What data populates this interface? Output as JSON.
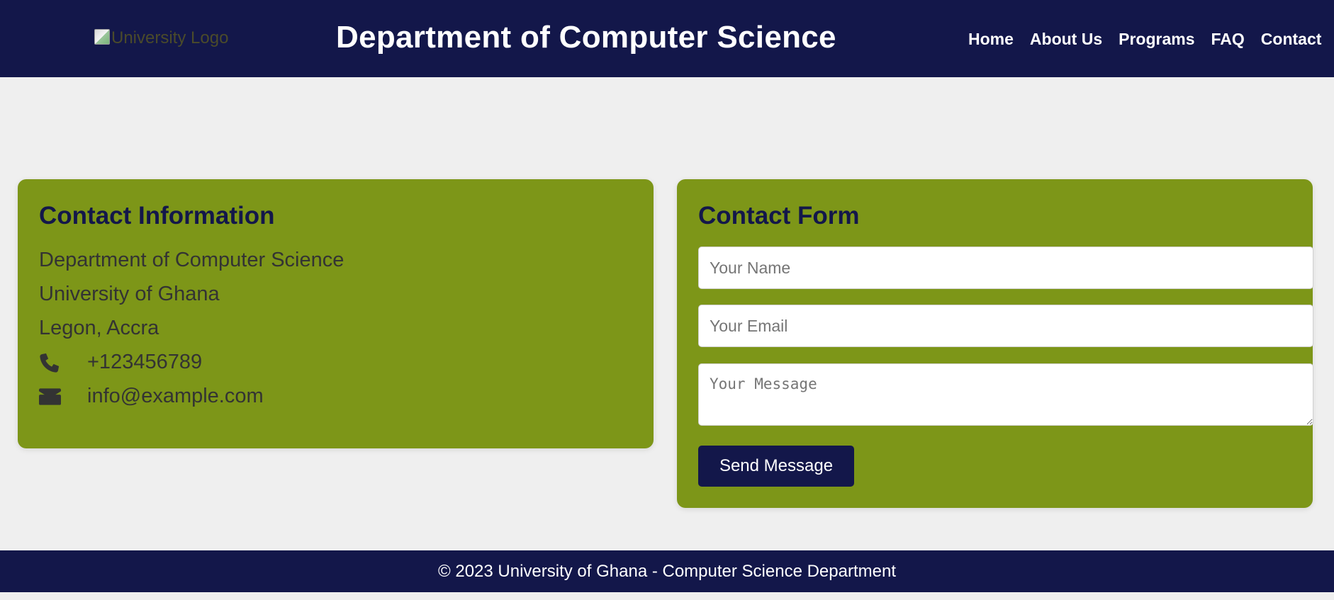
{
  "header": {
    "logo_alt": "University Logo",
    "title": "Department of Computer Science",
    "nav": [
      {
        "label": "Home"
      },
      {
        "label": "About Us"
      },
      {
        "label": "Programs"
      },
      {
        "label": "FAQ"
      },
      {
        "label": "Contact"
      }
    ]
  },
  "contact_info": {
    "heading": "Contact Information",
    "lines": [
      "Department of Computer Science",
      "University of Ghana",
      "Legon, Accra"
    ],
    "phone": "+123456789",
    "phone_icon": "phone-icon",
    "email": "info@example.com",
    "email_icon": "envelope-icon"
  },
  "contact_form": {
    "heading": "Contact Form",
    "name_placeholder": "Your Name",
    "email_placeholder": "Your Email",
    "message_placeholder": "Your Message",
    "submit_label": "Send Message"
  },
  "footer": {
    "text": "© 2023 University of Ghana - Computer Science Department"
  },
  "colors": {
    "primary": "#13174a",
    "card_background": "#7d9618",
    "page_background": "#efefef"
  }
}
